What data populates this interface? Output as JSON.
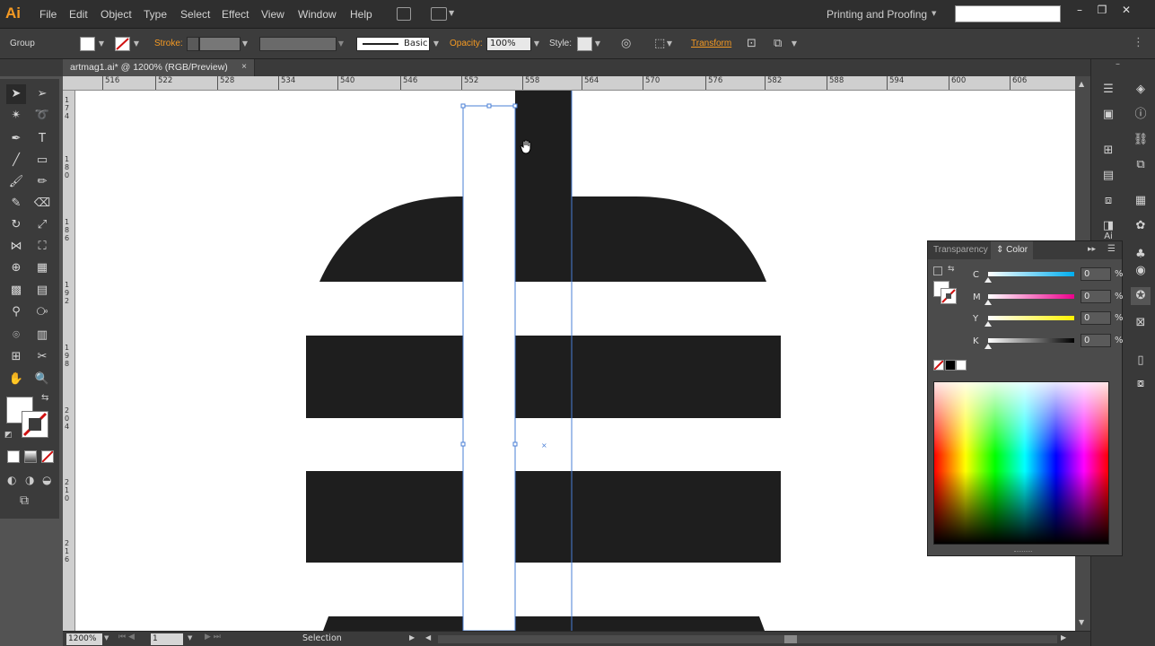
{
  "app": {
    "logo": "Ai",
    "workspace": "Printing and Proofing"
  },
  "menu": [
    "File",
    "Edit",
    "Object",
    "Type",
    "Select",
    "Effect",
    "View",
    "Window",
    "Help"
  ],
  "control_bar": {
    "selection_type": "Group",
    "stroke_label": "Stroke:",
    "stroke_profile": "Basic",
    "opacity_label": "Opacity:",
    "opacity_value": "100%",
    "style_label": "Style:",
    "transform_link": "Transform"
  },
  "document": {
    "tab_title": "artmag1.ai* @ 1200% (RGB/Preview)",
    "close": "×"
  },
  "ruler_h": [
    "516",
    "522",
    "528",
    "534",
    "540",
    "546",
    "552",
    "558",
    "564",
    "570",
    "576",
    "582",
    "588",
    "594",
    "600",
    "606"
  ],
  "ruler_v": [
    "174",
    "180",
    "186",
    "192",
    "198",
    "204",
    "210",
    "216"
  ],
  "status": {
    "zoom": "1200%",
    "artboard": "1",
    "tool": "Selection"
  },
  "color_panel": {
    "tab_transparency": "Transparency",
    "tab_color": "Color",
    "sliders": [
      {
        "label": "C",
        "value": "0",
        "unit": "%"
      },
      {
        "label": "M",
        "value": "0",
        "unit": "%"
      },
      {
        "label": "Y",
        "value": "0",
        "unit": "%"
      },
      {
        "label": "K",
        "value": "0",
        "unit": "%"
      }
    ]
  },
  "colors": {
    "accent": "#f59a23",
    "artwork": "#1e1e1e",
    "selection": "#4a7fd6"
  }
}
